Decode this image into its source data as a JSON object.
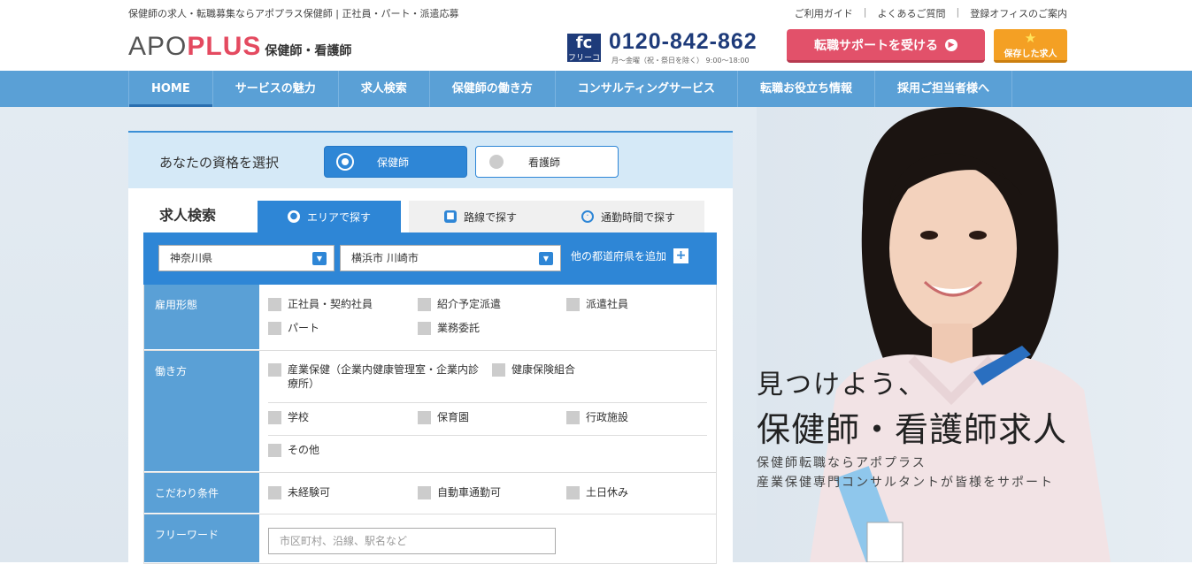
{
  "header": {
    "tagline": "保健師の求人・転職募集ならアポプラス保健師 | 正社員・パート・派遣応募",
    "links": [
      "ご利用ガイド",
      "よくあるご質問",
      "登録オフィスのご案内"
    ],
    "logo_a": "APO",
    "logo_b": "PLUS",
    "logo_c": "保健師・看護師",
    "freecall_mark": "fc",
    "freecall_label": "フリーコール",
    "phone": "0120-842-862",
    "hours": "月～金曜（祝・祭日を除く） 9:00～18:00",
    "support_button": "転職サポートを受ける",
    "saved_button": "保存した求人"
  },
  "nav": {
    "items": [
      "HOME",
      "サービスの魅力",
      "求人検索",
      "保健師の働き方",
      "コンサルティングサービス",
      "転職お役立ち情報",
      "採用ご担当者様へ"
    ]
  },
  "hero": {
    "line1": "見つけよう、",
    "line2": "保健師・看護師求人",
    "line3": "保健師転職ならアポプラス",
    "line4": "産業保健専門コンサルタントが皆様をサポート"
  },
  "qualification": {
    "title": "あなたの資格を選択",
    "options": [
      "保健師",
      "看護師"
    ],
    "selected": "保健師"
  },
  "search": {
    "title": "求人検索",
    "tabs": [
      "エリアで探す",
      "路線で探す",
      "通勤時間で探す"
    ],
    "prefecture": "神奈川県",
    "city": "横浜市 川崎市",
    "add_prefecture": "他の都道府県を追加",
    "employment": {
      "label": "雇用形態",
      "options": [
        "正社員・契約社員",
        "紹介予定派遣",
        "派遣社員",
        "パート",
        "業務委託"
      ]
    },
    "workstyle": {
      "label": "働き方",
      "options": [
        "産業保健（企業内健康管理室・企業内診療所）",
        "健康保険組合",
        "学校",
        "保育園",
        "行政施設",
        "その他"
      ]
    },
    "conditions": {
      "label": "こだわり条件",
      "options": [
        "未経験可",
        "自動車通勤可",
        "土日休み"
      ]
    },
    "freeword": {
      "label": "フリーワード",
      "placeholder": "市区町村、沿線、駅名など"
    }
  },
  "colors": {
    "nav": "#5aa0d6",
    "accent": "#2e86d6",
    "support": "#e2516a",
    "saved": "#f4a024"
  }
}
